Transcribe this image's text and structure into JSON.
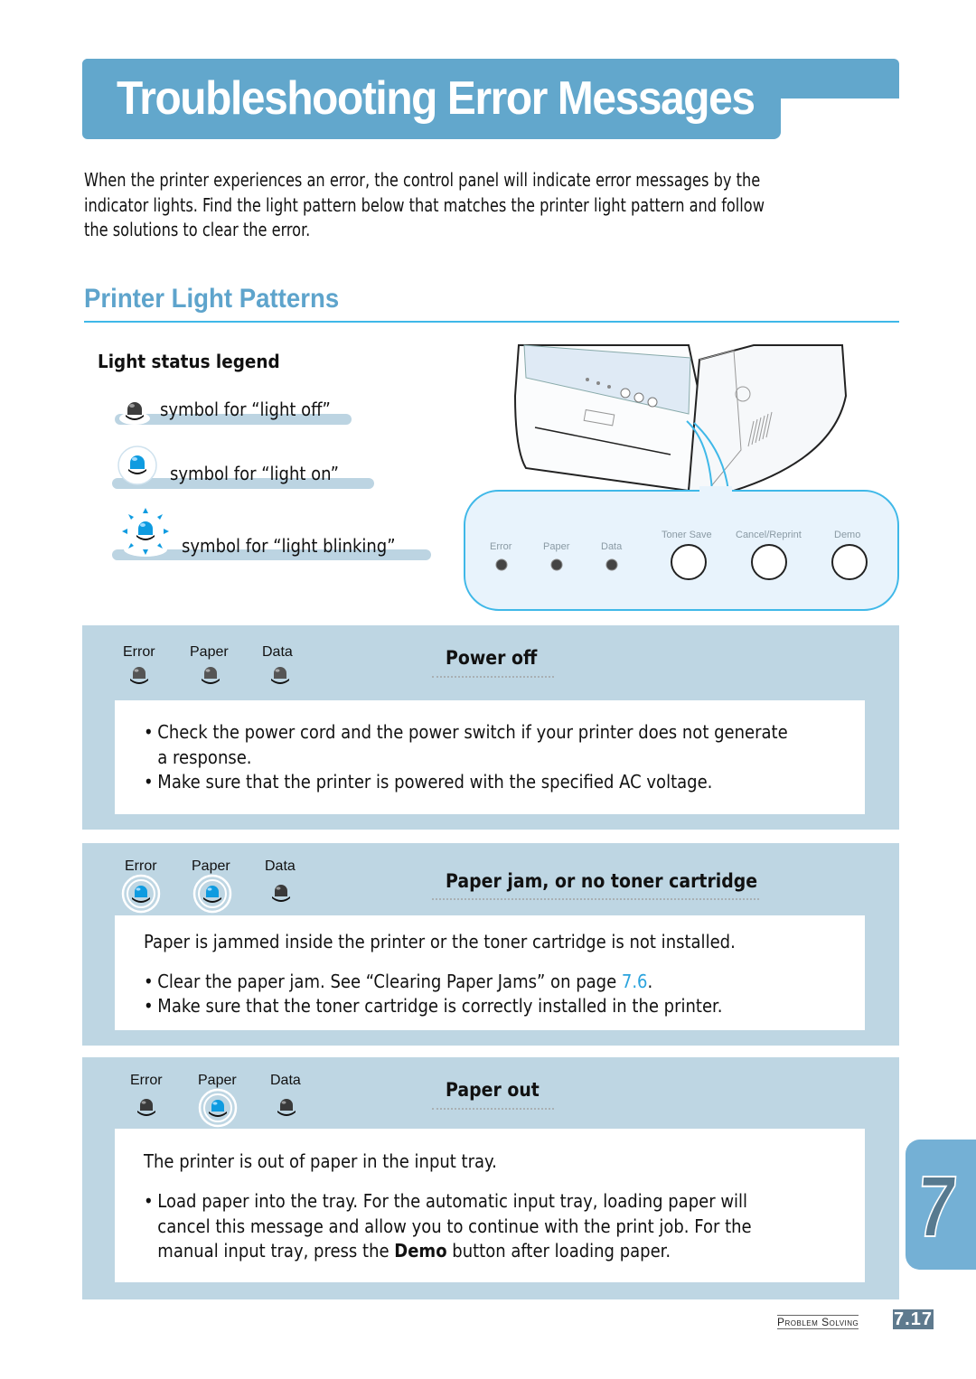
{
  "page": {
    "title": "Troubleshooting Error Messages",
    "intro": "When the printer experiences an error, the control panel will indicate error messages by the indicator lights. Find the light pattern below that matches the printer light pattern and follow the solutions to clear the error.",
    "intro_lines": [
      "When the printer experiences an error, the control panel will indicate error messages by the",
      "indicator lights. Find the light pattern below that matches the printer light pattern and follow",
      "the solutions to clear the error."
    ],
    "section_heading": "Printer Light Patterns"
  },
  "legend": {
    "title": "Light status legend",
    "items": [
      {
        "state": "off",
        "icon": "led-off-icon",
        "label": "symbol for “light off”"
      },
      {
        "state": "on",
        "icon": "led-on-icon",
        "label": "symbol for “light on”"
      },
      {
        "state": "blinking",
        "icon": "led-blinking-icon",
        "label": "symbol for “light blinking”"
      }
    ]
  },
  "control_panel": {
    "leds": [
      "Error",
      "Paper",
      "Data"
    ],
    "buttons": [
      "Toner Save",
      "Cancel/Reprint",
      "Demo"
    ]
  },
  "patterns": [
    {
      "title": "Power off",
      "leds": [
        {
          "label": "Error",
          "state": "off"
        },
        {
          "label": "Paper",
          "state": "off"
        },
        {
          "label": "Data",
          "state": "off"
        }
      ],
      "description": "",
      "bullets": [
        "Check the power cord and the power switch if your printer does not generate a response.",
        "Make sure that the printer is powered with the specified AC voltage."
      ]
    },
    {
      "title": "Paper jam, or no toner cartridge",
      "leds": [
        {
          "label": "Error",
          "state": "on"
        },
        {
          "label": "Paper",
          "state": "on"
        },
        {
          "label": "Data",
          "state": "off"
        }
      ],
      "description": "Paper is jammed inside the printer or the toner cartridge is not installed.",
      "bullets": [
        {
          "before": "Clear the paper jam. See “Clearing Paper Jams” on page ",
          "link": "7.6",
          "after": "."
        },
        "Make sure that the toner cartridge is correctly installed in the printer."
      ]
    },
    {
      "title": "Paper out",
      "leds": [
        {
          "label": "Error",
          "state": "off"
        },
        {
          "label": "Paper",
          "state": "on"
        },
        {
          "label": "Data",
          "state": "off"
        }
      ],
      "description": "The printer is out of paper in the input tray.",
      "bullets": [
        {
          "before": "Load paper into the tray. For the automatic input tray, loading paper will cancel this message and allow you to continue with the print job. For the manual input tray, press the ",
          "bold": "Demo",
          "after": " button after loading paper."
        }
      ]
    }
  ],
  "chapter_tab": {
    "number": "7"
  },
  "footer": {
    "section": "Problem Solving",
    "page": "7.17"
  },
  "colors": {
    "accent": "#62a7cc",
    "heading": "#5ea4cc",
    "card_bg": "#bed6e3",
    "led_on": "#0e9be0",
    "led_off": "#3a3a3a",
    "link": "#2aa3dd",
    "footer_page_bg": "#5e7a8e"
  }
}
